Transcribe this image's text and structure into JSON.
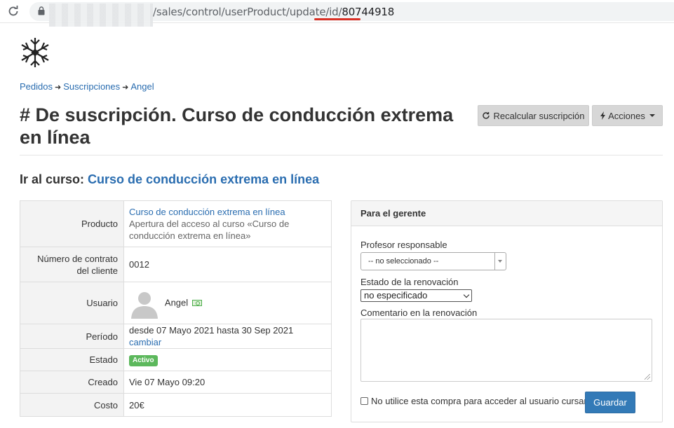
{
  "browser": {
    "url_visible": "/sales/control/userProduct/update/id/",
    "url_id": "80744918"
  },
  "breadcrumb": {
    "items": [
      "Pedidos",
      "Suscripciones",
      "Angel"
    ]
  },
  "header": {
    "title": "# De suscripción. Curso de conducción extrema en línea",
    "recalc_button": "Recalcular suscripción",
    "actions_button": "Acciones"
  },
  "goto": {
    "label": "Ir al curso:",
    "link": "Curso de conducción extrema en línea"
  },
  "details": {
    "product_label": "Producto",
    "product_link": "Curso de conducción extrema en línea",
    "product_desc": "Apertura del acceso al curso «Curso de conducción extrema en línea»",
    "contract_label": "Número de contrato del cliente",
    "contract_value": "0012",
    "user_label": "Usuario",
    "user_name": "Angel",
    "period_label": "Período",
    "period_value": "desde 07 Mayo 2021 hasta 30 Sep 2021",
    "period_change": "cambiar",
    "status_label": "Estado",
    "status_value": "Activo",
    "created_label": "Creado",
    "created_value": "Vie 07 Mayo 09:20",
    "cost_label": "Costo",
    "cost_value": "20€"
  },
  "manager": {
    "title": "Para el gerente",
    "teacher_label": "Profesor responsable",
    "teacher_value": "-- no seleccionado --",
    "renewal_label": "Estado de la renovación",
    "renewal_value": "no especificado",
    "comment_label": "Comentario en la renovación",
    "checkbox_label": "No utilice esta compra para acceder al usuario cursante",
    "save_button": "Guardar"
  },
  "colors": {
    "link": "#2a6db0",
    "primary": "#337ab7",
    "success": "#5cb85c",
    "url_highlight": "#d93025"
  }
}
